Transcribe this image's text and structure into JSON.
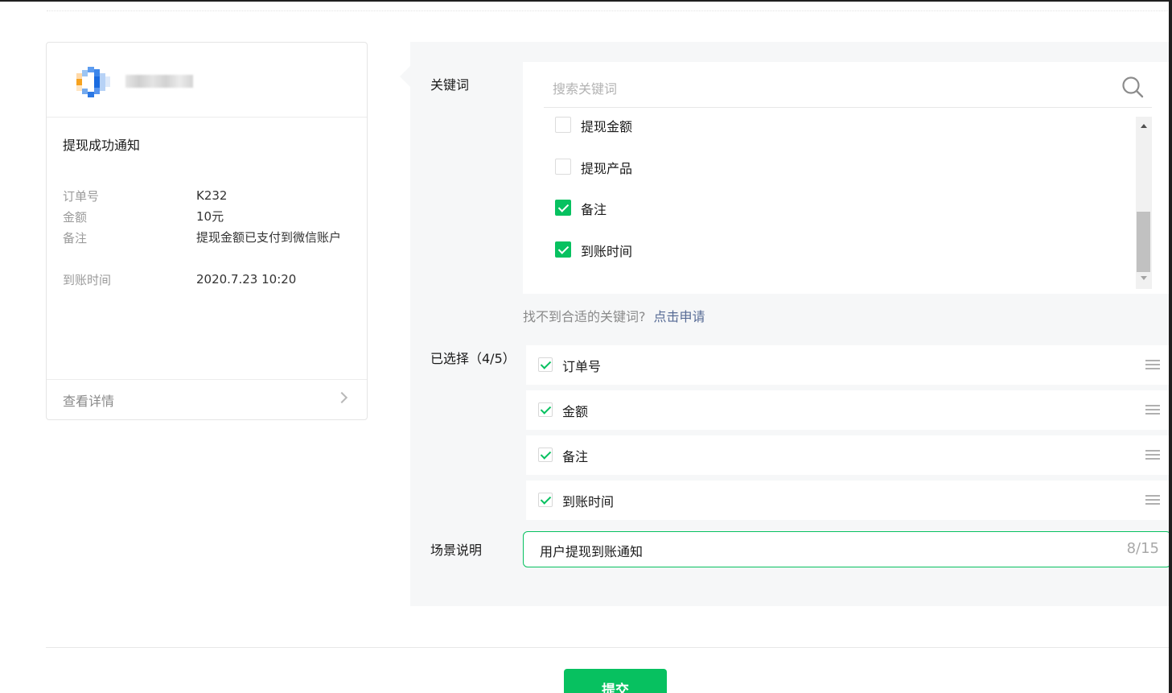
{
  "preview": {
    "title": "提现成功通知",
    "fields": [
      {
        "key": "订单号",
        "value": "K232"
      },
      {
        "key": "金额",
        "value": "10元"
      },
      {
        "key": "备注",
        "value": "提现金额已支付到微信账户"
      },
      {
        "key": "到账时间",
        "value": "2020.7.23 10:20"
      }
    ],
    "detail_label": "查看详情"
  },
  "keywords": {
    "label": "关键词",
    "search_placeholder": "搜索关键词",
    "options": [
      {
        "label": "提现金额",
        "checked": false
      },
      {
        "label": "提现产品",
        "checked": false
      },
      {
        "label": "备注",
        "checked": true
      },
      {
        "label": "到账时间",
        "checked": true
      }
    ],
    "hint": "找不到合适的关键词?",
    "hint_link": "点击申请"
  },
  "selected": {
    "label": "已选择（4/5）",
    "items": [
      "订单号",
      "金额",
      "备注",
      "到账时间"
    ]
  },
  "scene": {
    "label": "场景说明",
    "value": "用户提现到账通知",
    "counter": "8/15"
  },
  "submit_label": "提交",
  "colors": {
    "accent": "#07c160",
    "link": "#576b95"
  }
}
